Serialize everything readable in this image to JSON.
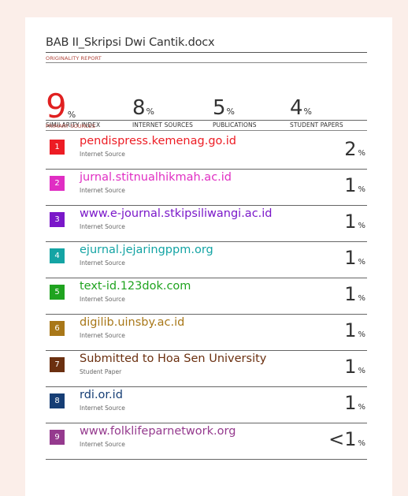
{
  "document": {
    "title": "BAB II_Skripsi Dwi Cantik.docx"
  },
  "originality_report": {
    "label": "ORIGINALITY REPORT",
    "stats": [
      {
        "value": "9",
        "unit": "%",
        "caption": "SIMILARITY INDEX"
      },
      {
        "value": "8",
        "unit": "%",
        "caption": "INTERNET SOURCES"
      },
      {
        "value": "5",
        "unit": "%",
        "caption": "PUBLICATIONS"
      },
      {
        "value": "4",
        "unit": "%",
        "caption": "STUDENT PAPERS"
      }
    ]
  },
  "primary_sources": {
    "label": "PRIMARY SOURCES",
    "items": [
      {
        "rank": "1",
        "name": "pendispress.kemenag.go.id",
        "type": "Internet Source",
        "value": "2",
        "unit": "%",
        "color": "#ed1c24"
      },
      {
        "rank": "2",
        "name": "jurnal.stitnualhikmah.ac.id",
        "type": "Internet Source",
        "value": "1",
        "unit": "%",
        "color": "#e02ec3"
      },
      {
        "rank": "3",
        "name": "www.e-journal.stkipsiliwangi.ac.id",
        "type": "Internet Source",
        "value": "1",
        "unit": "%",
        "color": "#7a17c9"
      },
      {
        "rank": "4",
        "name": "ejurnal.jejaringppm.org",
        "type": "Internet Source",
        "value": "1",
        "unit": "%",
        "color": "#14a4a4"
      },
      {
        "rank": "5",
        "name": "text-id.123dok.com",
        "type": "Internet Source",
        "value": "1",
        "unit": "%",
        "color": "#1fa31f"
      },
      {
        "rank": "6",
        "name": "digilib.uinsby.ac.id",
        "type": "Internet Source",
        "value": "1",
        "unit": "%",
        "color": "#a87718"
      },
      {
        "rank": "7",
        "name": "Submitted to Hoa Sen University",
        "type": "Student Paper",
        "value": "1",
        "unit": "%",
        "color": "#6b3010"
      },
      {
        "rank": "8",
        "name": "rdi.or.id",
        "type": "Internet Source",
        "value": "1",
        "unit": "%",
        "color": "#163e75"
      },
      {
        "rank": "9",
        "name": "www.folklifeparnetwork.org",
        "type": "Internet Source",
        "value": "<1",
        "unit": "%",
        "color": "#953a8e"
      }
    ]
  }
}
